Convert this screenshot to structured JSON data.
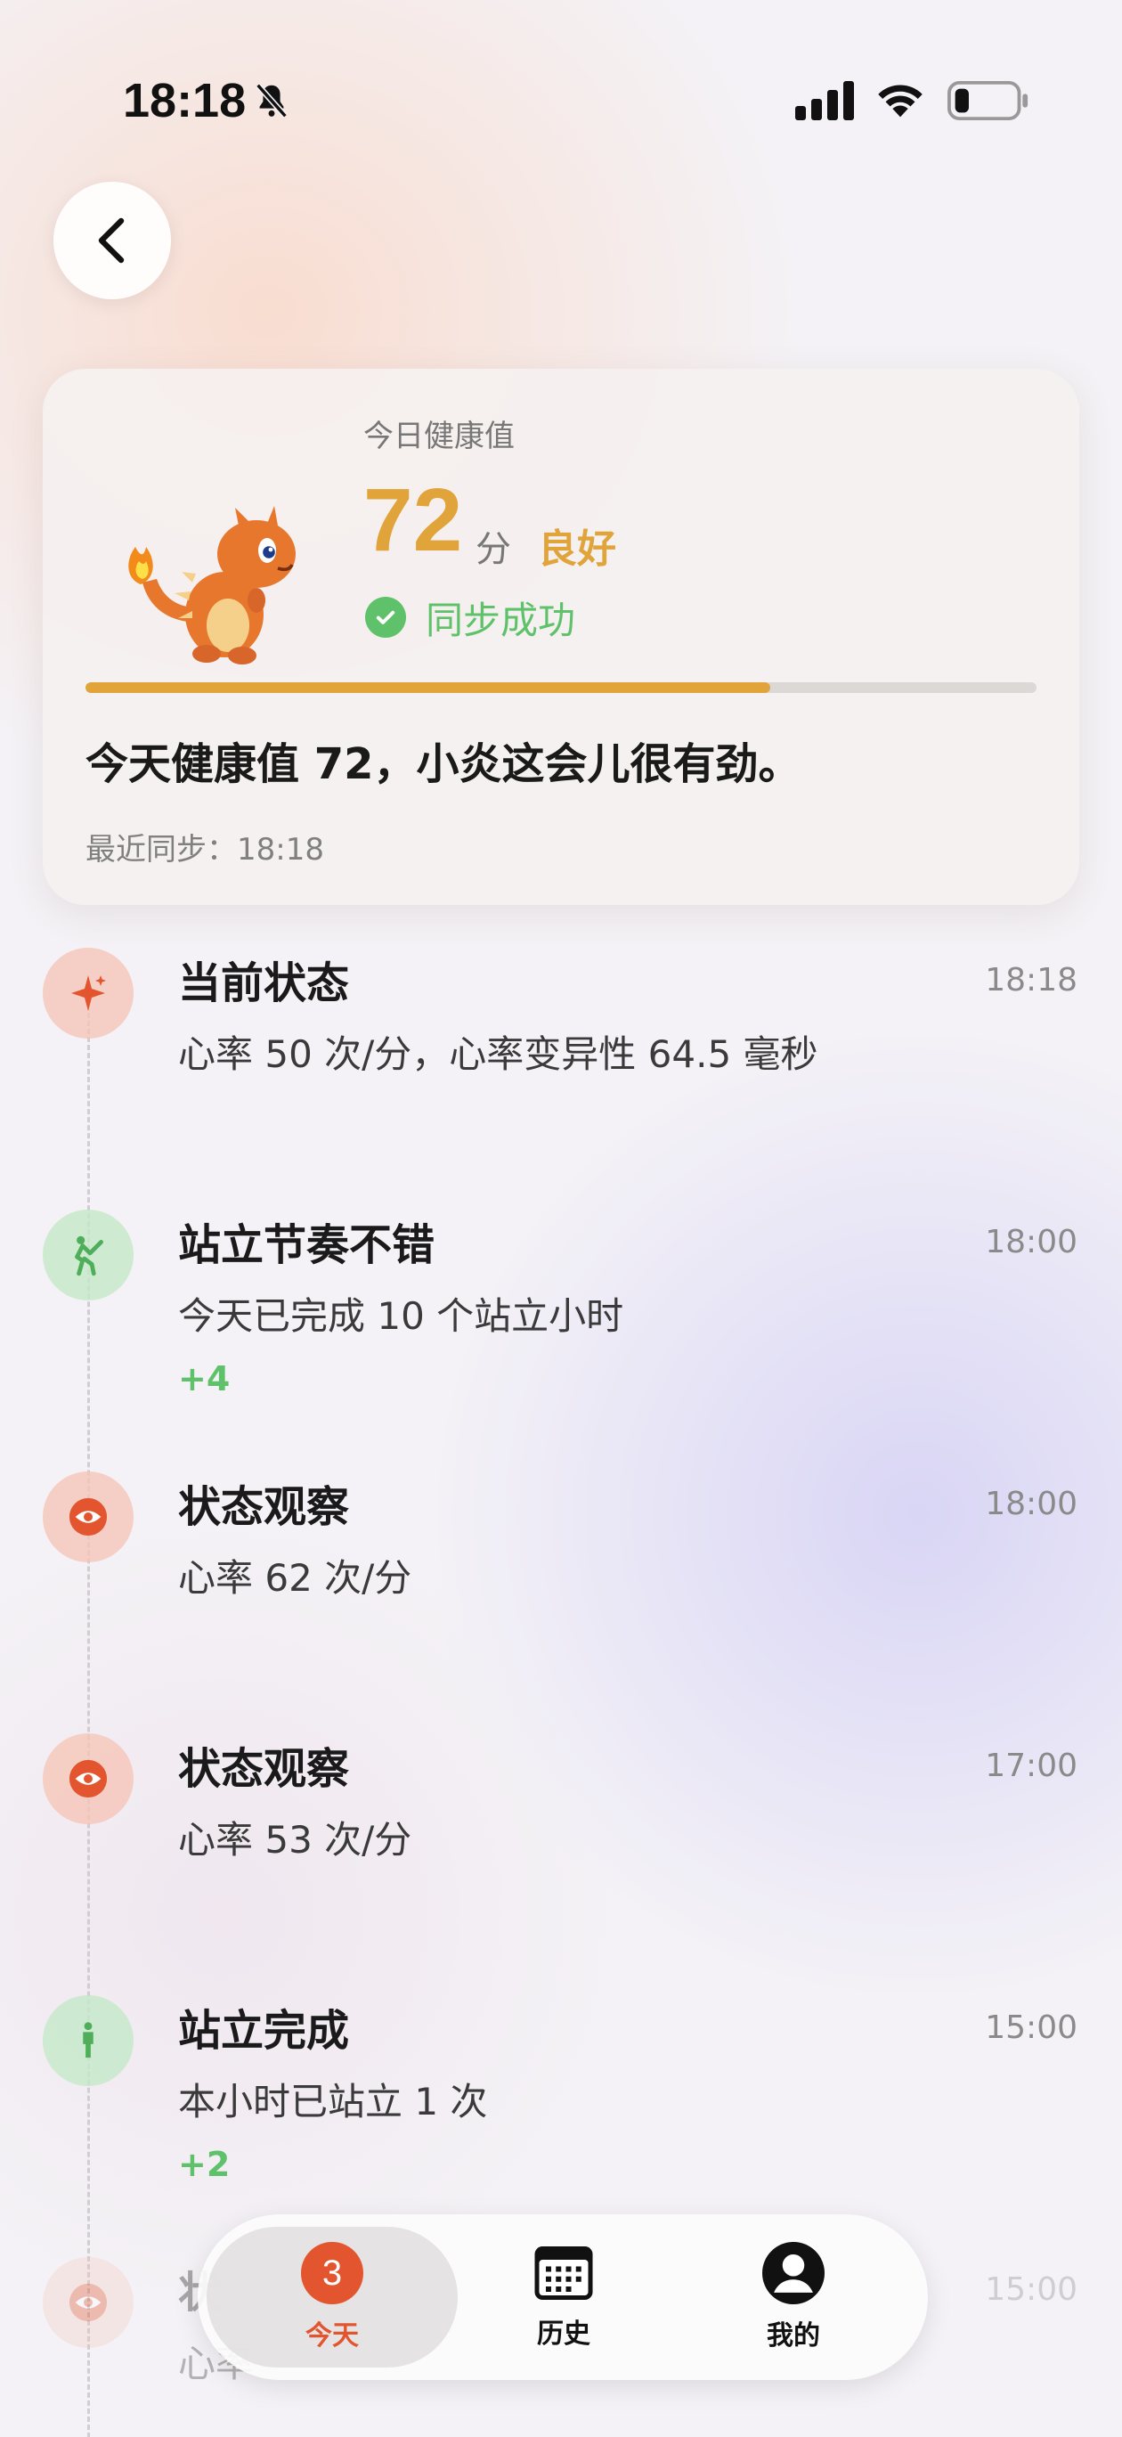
{
  "status_bar": {
    "time": "18:18",
    "icons": [
      "bell-slash-icon",
      "cellular-signal-icon",
      "wifi-icon",
      "battery-icon"
    ]
  },
  "nav": {
    "back_icon": "chevron-left-icon"
  },
  "health_card": {
    "label": "今日健康值",
    "score": "72",
    "unit": "分",
    "rating": "良好",
    "sync_status": "同步成功",
    "progress_fraction": 0.72,
    "summary": "今天健康值 72，小炎这会儿很有劲。",
    "last_sync": "最近同步：18:18",
    "mascot_icon": "fire-dragon-mascot"
  },
  "timeline": [
    {
      "icon": "sparkle-icon",
      "tone": "orange",
      "title": "当前状态",
      "time": "18:18",
      "desc": "心率 50 次/分，心率变异性 64.5 毫秒",
      "bonus": ""
    },
    {
      "icon": "stretch-icon",
      "tone": "green",
      "title": "站立节奏不错",
      "time": "18:00",
      "desc": "今天已完成 10 个站立小时",
      "bonus": "+4"
    },
    {
      "icon": "eye-icon",
      "tone": "orange",
      "title": "状态观察",
      "time": "18:00",
      "desc": "心率 62 次/分",
      "bonus": ""
    },
    {
      "icon": "eye-icon",
      "tone": "orange",
      "title": "状态观察",
      "time": "17:00",
      "desc": "心率 53 次/分",
      "bonus": ""
    },
    {
      "icon": "standing-person-icon",
      "tone": "green",
      "title": "站立完成",
      "time": "15:00",
      "desc": "本小时已站立 1 次",
      "bonus": "+2"
    },
    {
      "icon": "eye-icon",
      "tone": "orange",
      "title": "状",
      "time": "15:00",
      "desc": "心率",
      "bonus": ""
    }
  ],
  "tabbar": {
    "tabs": [
      {
        "label": "今天",
        "icon": "today-badge-icon",
        "badge": "3",
        "active": true
      },
      {
        "label": "历史",
        "icon": "calendar-icon",
        "active": false
      },
      {
        "label": "我的",
        "icon": "person-icon",
        "active": false
      }
    ]
  },
  "colors": {
    "accent_gold": "#e0a43a",
    "success_green": "#5fc26a",
    "brand_orange": "#e2552e"
  }
}
